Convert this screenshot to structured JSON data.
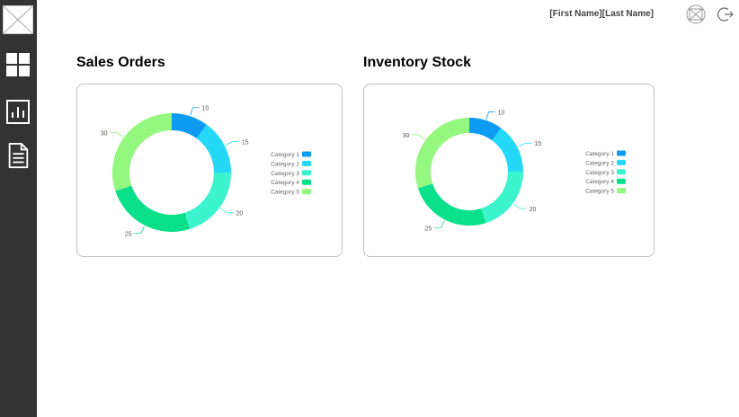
{
  "header": {
    "user_name": "[First Name][Last Name]"
  },
  "sidebar": {
    "items": [
      {
        "name": "logo-placeholder-icon"
      },
      {
        "name": "dashboard-icon"
      },
      {
        "name": "bar-chart-icon"
      },
      {
        "name": "document-icon"
      }
    ]
  },
  "colors": {
    "sidebar": "#333333",
    "category_1": "#0c9bf0",
    "category_2": "#25d8f8",
    "category_3": "#3bf3cd",
    "category_4": "#0ae08a",
    "category_5": "#94f77f"
  },
  "cards": {
    "sales": {
      "title": "Sales Orders"
    },
    "inventory": {
      "title": "Inventory Stock"
    }
  },
  "chart_data": [
    {
      "type": "pie",
      "title": "Sales Orders",
      "categories": [
        "Category 1",
        "Category 2",
        "Category 3",
        "Category 4",
        "Category 5"
      ],
      "values": [
        10,
        15,
        20,
        25,
        30
      ],
      "colors": [
        "#0c9bf0",
        "#25d8f8",
        "#3bf3cd",
        "#0ae08a",
        "#94f77f"
      ],
      "legend": "right"
    },
    {
      "type": "pie",
      "title": "Inventory Stock",
      "categories": [
        "Category 1",
        "Category 2",
        "Category 3",
        "Category 4",
        "Category 5"
      ],
      "values": [
        10,
        15,
        20,
        25,
        30
      ],
      "colors": [
        "#0c9bf0",
        "#25d8f8",
        "#3bf3cd",
        "#0ae08a",
        "#94f77f"
      ],
      "legend": "right"
    }
  ]
}
